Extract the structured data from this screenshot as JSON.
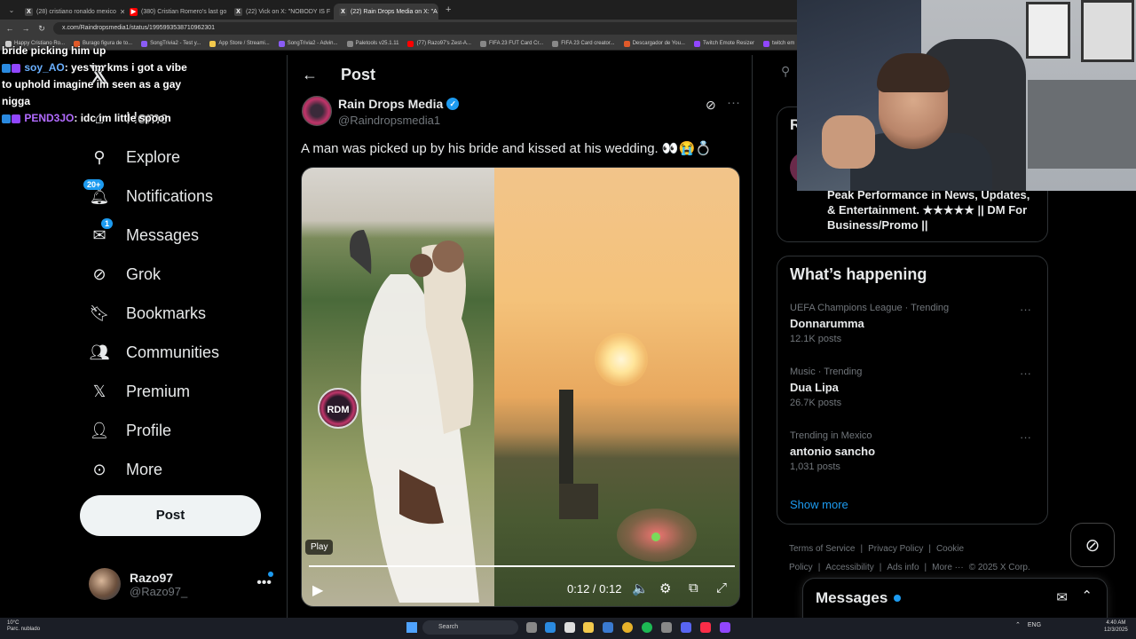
{
  "browser": {
    "tabs": [
      {
        "title": "(28) cristiano ronaldo mexico",
        "favicon_color": "#444444",
        "favicon_glyph": "X"
      },
      {
        "title": "(380) Cristian Romero's last go",
        "favicon_color": "#ff0000",
        "favicon_glyph": "▶"
      },
      {
        "title": "(22) Vick on X: \"NOBODY IS F",
        "favicon_color": "#444444",
        "favicon_glyph": "X"
      },
      {
        "title": "(22) Rain Drops Media on X: \"A",
        "favicon_color": "#444444",
        "favicon_glyph": "X",
        "active": true
      }
    ],
    "new_tab_glyph": "+",
    "url": "x.com/Raindropsmedia1/status/1995993538710962301",
    "bookmarks": [
      {
        "label": "Happy Cristiano Ro...",
        "color": "#cccccc"
      },
      {
        "label": "Burago figura de to...",
        "color": "#e05a2a"
      },
      {
        "label": "SongTrivia2 - Test y...",
        "color": "#8a5cf5"
      },
      {
        "label": "App Store / Streami...",
        "color": "#f2c94c"
      },
      {
        "label": "SongTrivia2 - Advin...",
        "color": "#8a5cf5"
      },
      {
        "label": "Paletools v25.1.11",
        "color": "#888888"
      },
      {
        "label": "(77) Razo97's Zest-A...",
        "color": "#ff0000"
      },
      {
        "label": "FIFA 23 FUT Card Cr...",
        "color": "#888888"
      },
      {
        "label": "FIFA 23 Card creator...",
        "color": "#888888"
      },
      {
        "label": "Descargador de You...",
        "color": "#e05a2a"
      },
      {
        "label": "Twitch Emote Resizer",
        "color": "#9146ff"
      },
      {
        "label": "twitch em",
        "color": "#9146ff"
      }
    ]
  },
  "chat": [
    {
      "user": "",
      "text": "bride picking him up",
      "user_class": ""
    },
    {
      "user": "soy_AO",
      "text": ": yes im kms i got a vibe to uphold imagine im seen as a gay nigga",
      "user_class": ""
    },
    {
      "user": "PEND3JO",
      "text": ": idc im little spoon",
      "user_class": "purple"
    }
  ],
  "nav": {
    "items": [
      {
        "label": "Home",
        "icon": "home-icon"
      },
      {
        "label": "Explore",
        "icon": "search-icon"
      },
      {
        "label": "Notifications",
        "icon": "bell-icon",
        "badge": "20+"
      },
      {
        "label": "Messages",
        "icon": "envelope-icon",
        "badge": "1"
      },
      {
        "label": "Grok",
        "icon": "grok-icon"
      },
      {
        "label": "Bookmarks",
        "icon": "bookmark-icon"
      },
      {
        "label": "Communities",
        "icon": "communities-icon"
      },
      {
        "label": "Premium",
        "icon": "x-logo-icon"
      },
      {
        "label": "Profile",
        "icon": "person-icon"
      },
      {
        "label": "More",
        "icon": "more-circle-icon"
      }
    ],
    "post_button": "Post"
  },
  "account": {
    "name": "Razo97",
    "handle": "@Razo97_",
    "more": "•••"
  },
  "post": {
    "heading": "Post",
    "author_name": "Rain Drops Media",
    "author_handle": "@Raindropsmedia1",
    "text": "A man was picked up by his bride and kissed at his wedding. 👀😭💍",
    "media_logo": "RDM",
    "video": {
      "play_tooltip": "Play",
      "time": "0:12 / 0:12",
      "progress": 1.0
    }
  },
  "right": {
    "profile_card_letter": "R",
    "profile_bio": "Peak Performance in News, Updates, & Entertainment. ★★★★★ || DM For Business/Promo ||",
    "trends_title": "What’s happening",
    "trends": [
      {
        "context": "UEFA Champions League · Trending",
        "name": "Donnarumma",
        "count": "12.1K posts"
      },
      {
        "context": "Music · Trending",
        "name": "Dua Lipa",
        "count": "26.7K posts"
      },
      {
        "context": "Trending in Mexico",
        "name": "antonio sancho",
        "count": "1,031 posts"
      }
    ],
    "show_more": "Show more",
    "footer": [
      "Terms of Service",
      "|",
      "Privacy Policy",
      "|",
      "Cookie Policy",
      "|",
      "Accessibility",
      "|",
      "Ads info",
      "|",
      "More ···",
      "© 2025 X Corp."
    ],
    "messages_title": "Messages"
  },
  "taskbar": {
    "weather_temp": "10°C",
    "weather_desc": "Parc. nublado",
    "search_placeholder": "Search",
    "lang": "ENG",
    "time": "4:40 AM",
    "date": "12/3/2025"
  }
}
